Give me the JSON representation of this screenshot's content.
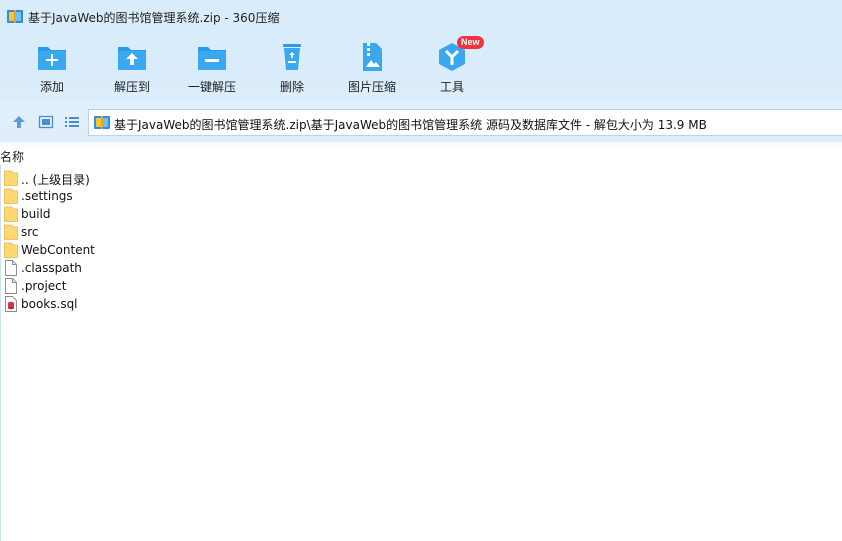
{
  "window": {
    "title": "基于JavaWeb的图书馆管理系统.zip - 360压缩"
  },
  "toolbar": {
    "buttons": [
      {
        "label": "添加",
        "icon": "add-folder-icon"
      },
      {
        "label": "解压到",
        "icon": "extract-to-icon"
      },
      {
        "label": "一键解压",
        "icon": "one-click-extract-icon"
      },
      {
        "label": "删除",
        "icon": "recycle-bin-icon"
      },
      {
        "label": "图片压缩",
        "icon": "image-compress-icon"
      },
      {
        "label": "工具",
        "icon": "tools-icon",
        "badge": "New"
      }
    ]
  },
  "navbar": {
    "up_icon": "up-arrow-icon",
    "view_icon": "thumbnail-view-icon",
    "list_icon": "list-view-icon",
    "path": "基于JavaWeb的图书馆管理系统.zip\\基于JavaWeb的图书馆管理系统 源码及数据库文件 - 解包大小为 13.9 MB"
  },
  "list": {
    "column_name": "名称",
    "items": [
      {
        "name": ".. (上级目录)",
        "type": "folder"
      },
      {
        "name": ".settings",
        "type": "folder"
      },
      {
        "name": "build",
        "type": "folder"
      },
      {
        "name": "src",
        "type": "folder"
      },
      {
        "name": "WebContent",
        "type": "folder"
      },
      {
        "name": ".classpath",
        "type": "file"
      },
      {
        "name": ".project",
        "type": "file"
      },
      {
        "name": "books.sql",
        "type": "sql"
      }
    ]
  },
  "colors": {
    "accent": "#2a9ae6",
    "titlebar_bg": "#d8ecfb",
    "folder": "#fcd772",
    "badge": "#f0323c"
  }
}
